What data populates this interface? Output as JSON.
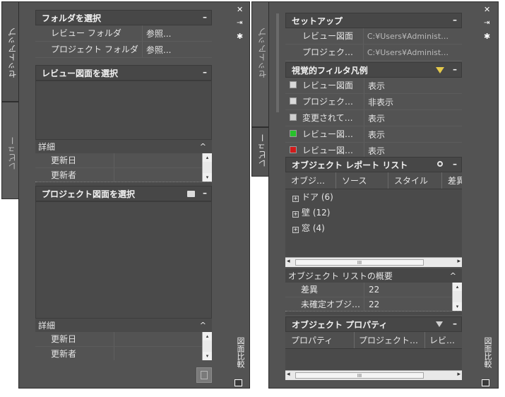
{
  "left": {
    "tabs": {
      "setup": "セットアップ",
      "review": "レビュー"
    },
    "side_label": "図面比較",
    "folders": {
      "title": "フォルダを選択",
      "rows": [
        {
          "label": "レビュー フォルダ",
          "value": "参照..."
        },
        {
          "label": "プロジェクト フォルダ",
          "value": "参照..."
        }
      ]
    },
    "review_dwg": {
      "title": "レビュー図面を選択",
      "details_label": "詳細",
      "details_rows": [
        "更新日",
        "更新者"
      ]
    },
    "project_dwg": {
      "title": "プロジェクト図面を選択",
      "details_label": "詳細",
      "details_rows": [
        "更新日",
        "更新者"
      ]
    }
  },
  "right": {
    "tabs": {
      "setup": "セットアップ",
      "review": "レビュー"
    },
    "side_label": "図面比較",
    "setup": {
      "title": "セットアップ",
      "rows": [
        {
          "label": "レビュー図面",
          "value": "C:¥Users¥Administ…"
        },
        {
          "label": "プロジェク…",
          "value": "C:¥Users¥Administ…"
        }
      ]
    },
    "legend": {
      "title": "視覚的フィルタ凡例",
      "rows": [
        {
          "label": "レビュー図面",
          "value": "表示",
          "color": "#d9d9d9"
        },
        {
          "label": "プロジェク…",
          "value": "非表示",
          "color": "#d9d9d9"
        },
        {
          "label": "変更されて…",
          "value": "表示",
          "color": "#cfcfcf"
        },
        {
          "label": "レビュー図…",
          "value": "表示",
          "color": "#27c22b"
        },
        {
          "label": "レビュー図…",
          "value": "表示",
          "color": "#d11b1b"
        }
      ]
    },
    "report": {
      "title": "オブジェクト レポート リスト",
      "columns": [
        "オブジ…",
        "ソース",
        "スタイル",
        "差異"
      ],
      "items": [
        "ドア (6)",
        "壁 (12)",
        "窓 (4)"
      ],
      "summary_title": "オブジェクト リストの概要",
      "summary_rows": [
        {
          "label": "差異",
          "value": "22"
        },
        {
          "label": "未確定オブジ…",
          "value": "22"
        }
      ]
    },
    "props": {
      "title": "オブジェクト プロパティ",
      "columns": [
        "プロパティ",
        "プロジェクト…",
        "レビュー…"
      ]
    }
  },
  "glyphs": {
    "minus": "–",
    "caret_up": "^",
    "close": "✕",
    "pin": "⇥",
    "gear": "✱",
    "hscroll_thumb": "III",
    "arrow_left": "◂",
    "arrow_right": "▸",
    "arrow_up": "▴",
    "arrow_down": "▾",
    "plus_box": "+"
  }
}
